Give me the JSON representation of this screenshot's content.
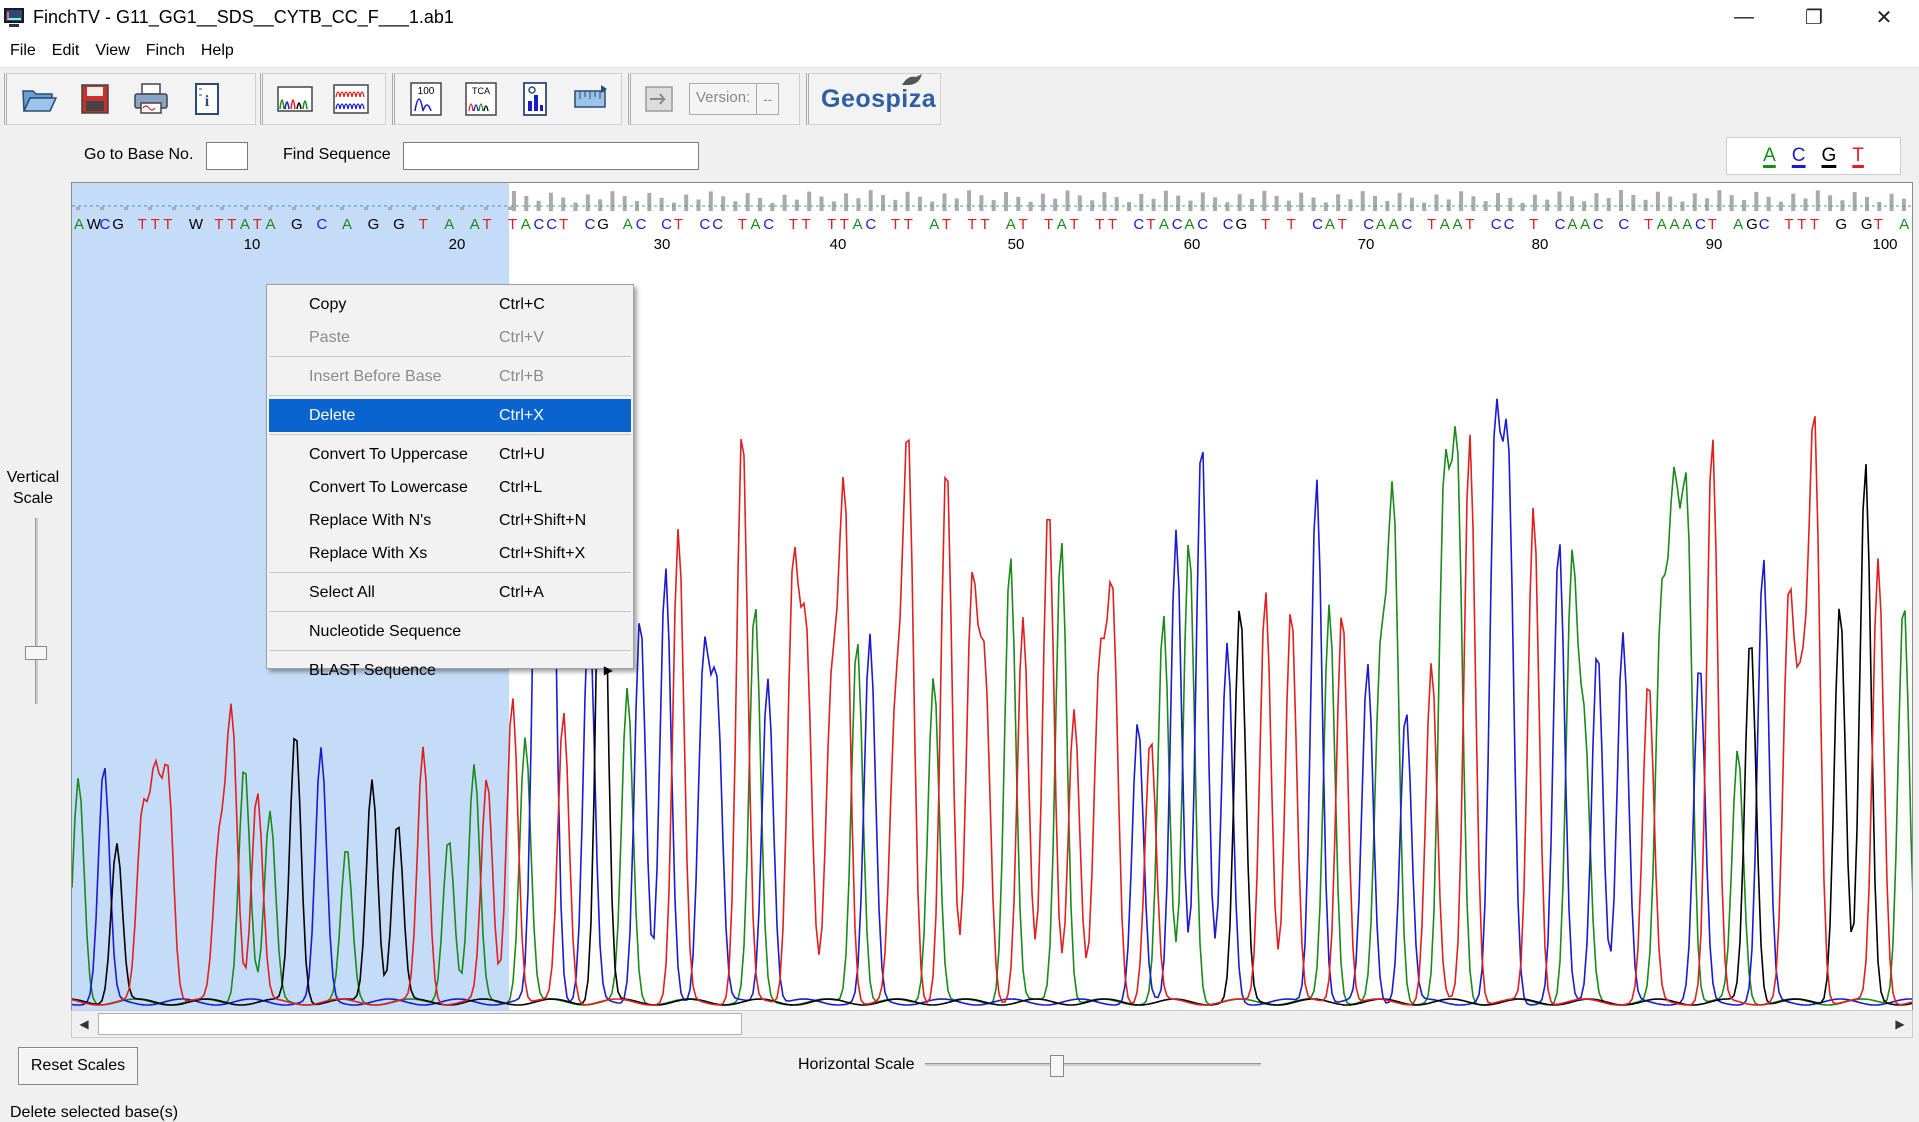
{
  "window": {
    "title": "FinchTV - G11_GG1__SDS__CYTB_CC_F___1.ab1",
    "controls": {
      "minimize": "—",
      "restore": "❐",
      "close": "✕"
    }
  },
  "menu": {
    "file": "File",
    "edit": "Edit",
    "view": "View",
    "finch": "Finch",
    "help": "Help"
  },
  "toolbar": {
    "icons": [
      "open-folder-icon",
      "save-icon",
      "print-icon",
      "info-icon",
      "chromatogram-icon",
      "multi-trace-icon",
      "quality-100-icon",
      "tca-icon",
      "quality-chart-icon",
      "scale-icon",
      "export-icon"
    ],
    "quality_label": "100",
    "tca_label": "TCA",
    "version_label": "Version:",
    "version_value": "--",
    "brand": "Geospiza"
  },
  "search": {
    "goto_label": "Go to Base No.",
    "goto_value": "",
    "find_label": "Find Sequence",
    "find_value": ""
  },
  "legend": [
    {
      "letter": "A",
      "color": "#1a8a1a"
    },
    {
      "letter": "C",
      "color": "#1a1ad0"
    },
    {
      "letter": "G",
      "color": "#000000"
    },
    {
      "letter": "T",
      "color": "#e02020"
    }
  ],
  "vertical_scale": {
    "line1": "Vertical",
    "line2": "Scale"
  },
  "sequence": {
    "bases": "AWCG TTT W TTATA G C A G G T A AT TACCT CG AC CT CC TAC TT TTAC TT AT TT AT TAT TT CTACAC CG T T CAT CAAC TAAT CC T CAAC C TAAACT AGC TTT G GT A",
    "ticks": [
      {
        "label": "10"
      },
      {
        "label": "20"
      },
      {
        "label": "30"
      },
      {
        "label": "40"
      },
      {
        "label": "50"
      },
      {
        "label": "60"
      },
      {
        "label": "70"
      },
      {
        "label": "80"
      },
      {
        "label": "90"
      },
      {
        "label": "100"
      }
    ],
    "selected_through_base": 22
  },
  "context_menu": {
    "items": [
      {
        "label": "Copy",
        "shortcut": "Ctrl+C",
        "state": "enabled"
      },
      {
        "label": "Paste",
        "shortcut": "Ctrl+V",
        "state": "disabled"
      },
      {
        "label": "Insert Before Base",
        "shortcut": "Ctrl+B",
        "state": "disabled"
      },
      {
        "label": "Delete",
        "shortcut": "Ctrl+X",
        "state": "active"
      },
      {
        "label": "Convert To Uppercase",
        "shortcut": "Ctrl+U",
        "state": "enabled"
      },
      {
        "label": "Convert To Lowercase",
        "shortcut": "Ctrl+L",
        "state": "enabled"
      },
      {
        "label": "Replace With N's",
        "shortcut": "Ctrl+Shift+N",
        "state": "enabled"
      },
      {
        "label": "Replace With Xs",
        "shortcut": "Ctrl+Shift+X",
        "state": "enabled"
      },
      {
        "label": "Select All",
        "shortcut": "Ctrl+A",
        "state": "enabled"
      },
      {
        "label": "Nucleotide Sequence",
        "shortcut": "",
        "state": "enabled"
      },
      {
        "label": "BLAST Sequence",
        "shortcut": "",
        "state": "submenu"
      }
    ]
  },
  "bottom": {
    "reset_label": "Reset Scales",
    "hscale_label": "Horizontal Scale",
    "status": "Delete selected base(s)"
  }
}
